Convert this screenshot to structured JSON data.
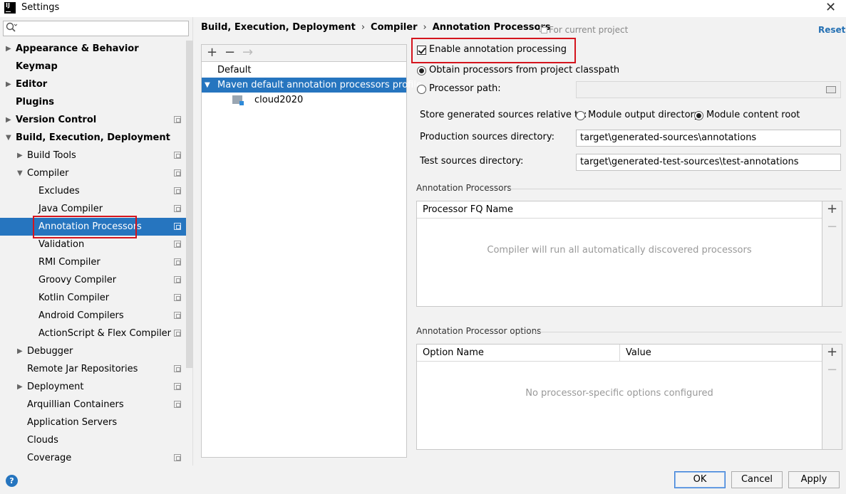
{
  "window": {
    "title": "Settings"
  },
  "search": {
    "placeholder": "",
    "value": ""
  },
  "sidebar": {
    "items": [
      {
        "label": "Appearance & Behavior",
        "bold": true,
        "chevron": "right",
        "indent": 0,
        "copy_icon": false
      },
      {
        "label": "Keymap",
        "bold": true,
        "chevron": "none",
        "indent": 0,
        "copy_icon": false
      },
      {
        "label": "Editor",
        "bold": true,
        "chevron": "right",
        "indent": 0,
        "copy_icon": false
      },
      {
        "label": "Plugins",
        "bold": true,
        "chevron": "none",
        "indent": 0,
        "copy_icon": false
      },
      {
        "label": "Version Control",
        "bold": true,
        "chevron": "right",
        "indent": 0,
        "copy_icon": true
      },
      {
        "label": "Build, Execution, Deployment",
        "bold": true,
        "chevron": "down",
        "indent": 0,
        "copy_icon": false
      },
      {
        "label": "Build Tools",
        "bold": false,
        "chevron": "right",
        "indent": 1,
        "copy_icon": true
      },
      {
        "label": "Compiler",
        "bold": false,
        "chevron": "down",
        "indent": 1,
        "copy_icon": true
      },
      {
        "label": "Excludes",
        "bold": false,
        "chevron": "none",
        "indent": 2,
        "copy_icon": true
      },
      {
        "label": "Java Compiler",
        "bold": false,
        "chevron": "none",
        "indent": 2,
        "copy_icon": true
      },
      {
        "label": "Annotation Processors",
        "bold": false,
        "chevron": "none",
        "indent": 2,
        "copy_icon": true,
        "selected": true
      },
      {
        "label": "Validation",
        "bold": false,
        "chevron": "none",
        "indent": 2,
        "copy_icon": true
      },
      {
        "label": "RMI Compiler",
        "bold": false,
        "chevron": "none",
        "indent": 2,
        "copy_icon": true
      },
      {
        "label": "Groovy Compiler",
        "bold": false,
        "chevron": "none",
        "indent": 2,
        "copy_icon": true
      },
      {
        "label": "Kotlin Compiler",
        "bold": false,
        "chevron": "none",
        "indent": 2,
        "copy_icon": true
      },
      {
        "label": "Android Compilers",
        "bold": false,
        "chevron": "none",
        "indent": 2,
        "copy_icon": true
      },
      {
        "label": "ActionScript & Flex Compiler",
        "bold": false,
        "chevron": "none",
        "indent": 2,
        "copy_icon": true
      },
      {
        "label": "Debugger",
        "bold": false,
        "chevron": "right",
        "indent": 1,
        "copy_icon": false
      },
      {
        "label": "Remote Jar Repositories",
        "bold": false,
        "chevron": "none",
        "indent": 1,
        "copy_icon": true
      },
      {
        "label": "Deployment",
        "bold": false,
        "chevron": "right",
        "indent": 1,
        "copy_icon": true
      },
      {
        "label": "Arquillian Containers",
        "bold": false,
        "chevron": "none",
        "indent": 1,
        "copy_icon": true
      },
      {
        "label": "Application Servers",
        "bold": false,
        "chevron": "none",
        "indent": 1,
        "copy_icon": false
      },
      {
        "label": "Clouds",
        "bold": false,
        "chevron": "none",
        "indent": 1,
        "copy_icon": false
      },
      {
        "label": "Coverage",
        "bold": false,
        "chevron": "none",
        "indent": 1,
        "copy_icon": true
      }
    ]
  },
  "breadcrumb": {
    "parts": [
      "Build, Execution, Deployment",
      "Compiler",
      "Annotation Processors"
    ],
    "separator": "›"
  },
  "scope_note": "For current project",
  "reset_label": "Reset",
  "profiles": {
    "toolbar": {
      "add": "+",
      "remove": "−",
      "move": "→"
    },
    "items": [
      {
        "label": "Default"
      },
      {
        "label": "Maven default annotation processors profile",
        "selected": true
      },
      {
        "label": "cloud2020"
      }
    ]
  },
  "settings": {
    "enable_processing": {
      "label": "Enable annotation processing",
      "checked": true
    },
    "obtain_from_classpath": {
      "label": "Obtain processors from project classpath",
      "selected": true
    },
    "processor_path": {
      "label": "Processor path:",
      "selected": false,
      "value": ""
    },
    "store_relative": {
      "label": "Store generated sources relative to:",
      "options": [
        "Module output directory",
        "Module content root"
      ],
      "selected": "Module content root"
    },
    "production_dir": {
      "label": "Production sources directory:",
      "value": "target\\generated-sources\\annotations"
    },
    "test_dir": {
      "label": "Test sources directory:",
      "value": "target\\generated-test-sources\\test-annotations"
    }
  },
  "processors_table": {
    "section_title": "Annotation Processors",
    "column": "Processor FQ Name",
    "empty_text": "Compiler will run all automatically discovered processors"
  },
  "options_table": {
    "section_title": "Annotation Processor options",
    "columns": [
      "Option Name",
      "Value"
    ],
    "empty_text": "No processor-specific options configured"
  },
  "buttons": {
    "ok": "OK",
    "cancel": "Cancel",
    "apply": "Apply"
  },
  "colors": {
    "selection": "#2675bf",
    "highlight_box": "#d4141d",
    "link": "#2470b3"
  },
  "icons": {
    "help": "?",
    "close": "✕"
  }
}
